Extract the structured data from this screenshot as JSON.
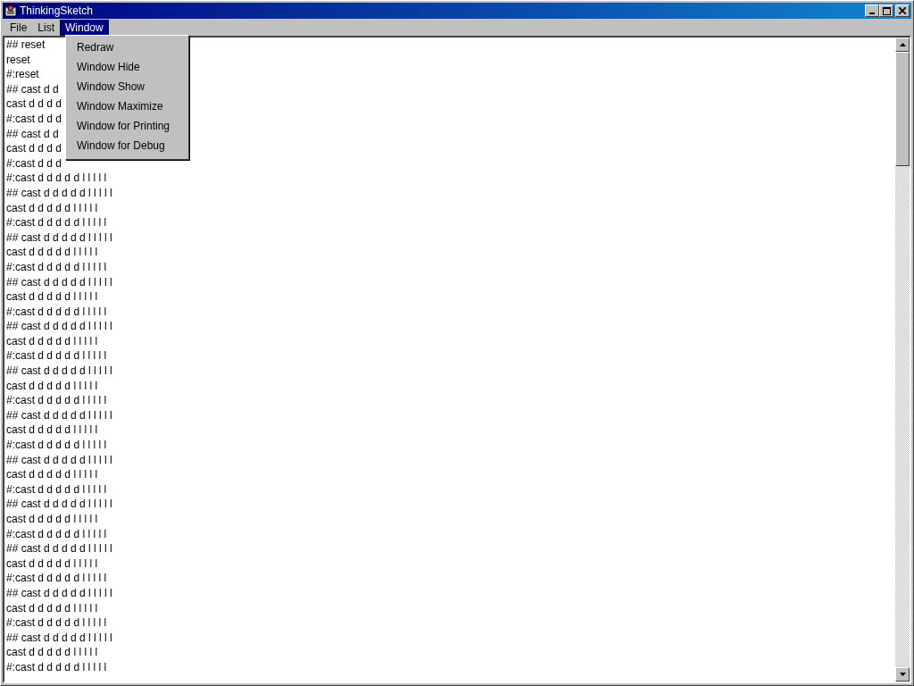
{
  "window": {
    "title": "ThinkingSketch"
  },
  "menu_bar": [
    {
      "label": "File",
      "selected": false
    },
    {
      "label": "List",
      "selected": false
    },
    {
      "label": "Window",
      "selected": true
    }
  ],
  "open_menu": {
    "items": [
      "Redraw",
      "Window Hide",
      "Window Show",
      "Window Maximize",
      "Window for Printing",
      "Window for Debug"
    ]
  },
  "text_area": {
    "lines": [
      "## reset",
      "reset",
      "#:reset",
      "## cast d d",
      "cast d d d d",
      "#:cast d d d",
      "## cast d d",
      "cast d d d d",
      "#:cast d d d",
      "#:cast d d d d d l l l l l",
      "## cast d d d d d l l l l l",
      "cast d d d d d l l l l l",
      "#:cast d d d d d l l l l l",
      "## cast d d d d d l l l l l",
      "cast d d d d d l l l l l",
      "#:cast d d d d d l l l l l",
      "## cast d d d d d l l l l l",
      "cast d d d d d l l l l l",
      "#:cast d d d d d l l l l l",
      "## cast d d d d d l l l l l",
      "cast d d d d d l l l l l",
      "#:cast d d d d d l l l l l",
      "## cast d d d d d l l l l l",
      "cast d d d d d l l l l l",
      "#:cast d d d d d l l l l l",
      "## cast d d d d d l l l l l",
      "cast d d d d d l l l l l",
      "#:cast d d d d d l l l l l",
      "## cast d d d d d l l l l l",
      "cast d d d d d l l l l l",
      "#:cast d d d d d l l l l l",
      "## cast d d d d d l l l l l",
      "cast d d d d d l l l l l",
      "#:cast d d d d d l l l l l",
      "## cast d d d d d l l l l l",
      "cast d d d d d l l l l l",
      "#:cast d d d d d l l l l l",
      "## cast d d d d d l l l l l",
      "cast d d d d d l l l l l",
      "#:cast d d d d d l l l l l",
      "## cast d d d d d l l l l l",
      "cast d d d d d l l l l l",
      "#:cast d d d d d l l l l l"
    ]
  }
}
